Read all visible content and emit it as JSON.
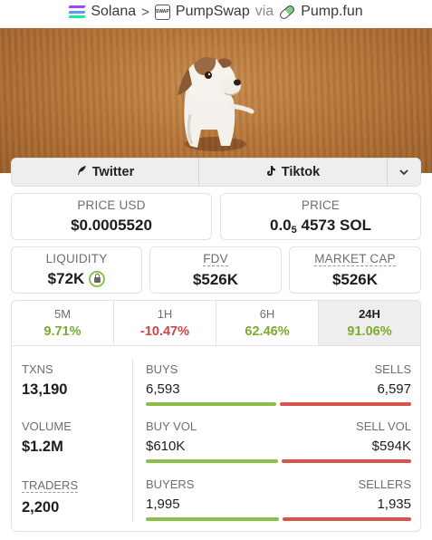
{
  "breadcrumb": {
    "chain": "Solana",
    "dex": "PumpSwap",
    "via": "via",
    "platform": "Pump.fun",
    "separator": ">"
  },
  "socials": {
    "twitter": "Twitter",
    "tiktok": "Tiktok"
  },
  "price": {
    "usd_label": "PRICE USD",
    "usd_value": "$0.0005520",
    "native_label": "PRICE",
    "native_prefix": "0.0",
    "native_zeros": "5",
    "native_digits": "4573 SOL"
  },
  "metrics": {
    "liquidity_label": "LIQUIDITY",
    "liquidity_value": "$72K",
    "fdv_label": "FDV",
    "fdv_value": "$526K",
    "mcap_label": "MARKET CAP",
    "mcap_value": "$526K"
  },
  "timeframes": [
    {
      "label": "5M",
      "value": "9.71%",
      "trend": "up"
    },
    {
      "label": "1H",
      "value": "-10.47%",
      "trend": "down"
    },
    {
      "label": "6H",
      "value": "62.46%",
      "trend": "up"
    },
    {
      "label": "24H",
      "value": "91.06%",
      "trend": "up",
      "active": true
    }
  ],
  "stats": {
    "txns_label": "TXNS",
    "txns_value": "13,190",
    "buys_label": "BUYS",
    "buys_value": "6,593",
    "sells_label": "SELLS",
    "sells_value": "6,597",
    "buys_share": 0.4998,
    "volume_label": "VOLUME",
    "volume_value": "$1.2M",
    "buy_vol_label": "BUY VOL",
    "buy_vol_value": "$610K",
    "sell_vol_label": "SELL VOL",
    "sell_vol_value": "$594K",
    "buy_vol_share": 0.5066,
    "traders_label": "TRADERS",
    "traders_value": "2,200",
    "buyers_label": "BUYERS",
    "buyers_value": "1,995",
    "sellers_label": "SELLERS",
    "sellers_value": "1,935",
    "buyers_share": 0.5076
  },
  "colors": {
    "positive": "#7bab2f",
    "negative": "#d04545",
    "buy_bar": "#8bbf4a",
    "sell_bar": "#d9534f"
  },
  "icons": {
    "chain": "solana-icon",
    "dex": "pumpswap-icon",
    "platform": "pill-icon",
    "twitter": "feather-icon",
    "tiktok": "tiktok-icon",
    "expand": "chevron-down-icon",
    "liquidity_lock": "lock-icon"
  }
}
